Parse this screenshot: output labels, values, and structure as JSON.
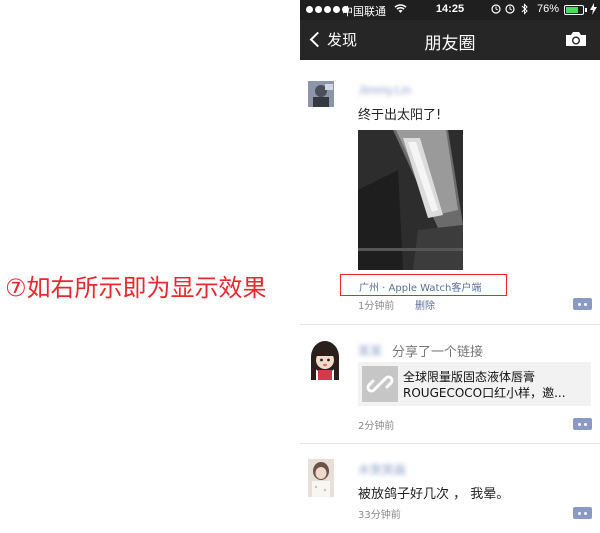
{
  "annotation": "⑦如右所示即为显示效果",
  "status_bar": {
    "carrier": "中国联通",
    "time": "14:25",
    "battery_percent": "76%",
    "battery_level": 0.76
  },
  "nav": {
    "back_label": "发现",
    "title": "朋友圈"
  },
  "posts": [
    {
      "username": "Jimmy.Lin",
      "text": "终于出太阳了!",
      "location": "广州 · Apple Watch客户端",
      "time": "1分钟前",
      "delete_label": "删除"
    },
    {
      "username": "某某",
      "share_text": "分享了一个链接",
      "link_title_line1": "全球限量版固态液体唇膏",
      "link_title_line2": "ROUGECOCO口红小样，邀...",
      "time": "2分钟前"
    },
    {
      "username": "木笑笑画",
      "text": "被放鸽子好几次 ， 我晕。",
      "time": "33分钟前"
    }
  ],
  "icons": [
    "signal-dots-icon",
    "wifi-icon",
    "alarm-icon",
    "bluetooth-icon",
    "battery-icon",
    "back-chevron-icon",
    "camera-icon",
    "link-icon",
    "comment-icon"
  ]
}
